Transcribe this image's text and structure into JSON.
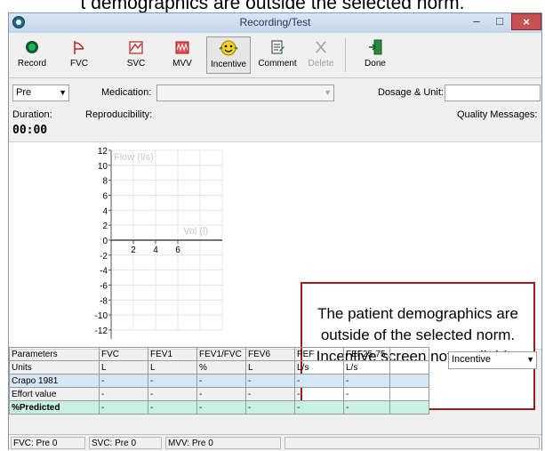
{
  "caption": "t demographics are outside the selected norm.",
  "window": {
    "title": "Recording/Test",
    "min": "–",
    "max": "□",
    "close": "×"
  },
  "toolbar": {
    "record": "Record",
    "fvc": "FVC",
    "svc": "SVC",
    "mvv": "MVV",
    "incentive": "Incentive",
    "comment": "Comment",
    "delete": "Delete",
    "done": "Done"
  },
  "form": {
    "stage": "Pre",
    "medication_label": "Medication:",
    "medication_value": "",
    "dosage_label": "Dosage & Unit:",
    "dosage_value": "",
    "duration_label": "Duration:",
    "duration_value": "00:00",
    "reproducibility_label": "Reproducibility:",
    "quality_label": "Quality Messages:"
  },
  "graph": {
    "y_label": "Flow (l/s)",
    "x_label": "Vol (l)",
    "y_ticks": [
      "12",
      "10",
      "8",
      "6",
      "4",
      "2",
      "0",
      "-2",
      "-4",
      "-6",
      "-8",
      "-10",
      "-12"
    ],
    "x_ticks": [
      "2",
      "4",
      "6"
    ]
  },
  "message": "The patient demographics are outside of the selected norm. Incentive screen not available.",
  "table": {
    "headers": [
      "Parameters",
      "FVC",
      "FEV1",
      "FEV1/FVC",
      "FEV6",
      "PEF",
      "FEF25-75"
    ],
    "rows": [
      [
        "Units",
        "L",
        "L",
        "%",
        "L",
        "L/s",
        "L/s"
      ],
      [
        "Crapo 1981",
        "-",
        "-",
        "-",
        "-",
        "-",
        "-"
      ],
      [
        "Effort value",
        "-",
        "-",
        "-",
        "-",
        "-",
        "-"
      ],
      [
        "%Predicted",
        "-",
        "-",
        "-",
        "-",
        "-",
        "-"
      ]
    ]
  },
  "view_select": "Incentive",
  "status": {
    "fvc": "FVC:  Pre 0",
    "svc": "SVC:  Pre 0",
    "mvv": "MVV:  Pre 0"
  },
  "icons": {
    "record": "record-icon",
    "fvc": "fvc-icon",
    "svc": "svc-icon",
    "mvv": "mvv-icon",
    "incentive": "smiley-icon",
    "comment": "comment-icon",
    "delete": "delete-icon",
    "done": "door-exit-icon"
  },
  "colors": {
    "message_border": "#a01c1c",
    "crapo_row": "#d4e7f7",
    "predicted_row": "#c9f1e1",
    "close_button": "#c75050"
  }
}
